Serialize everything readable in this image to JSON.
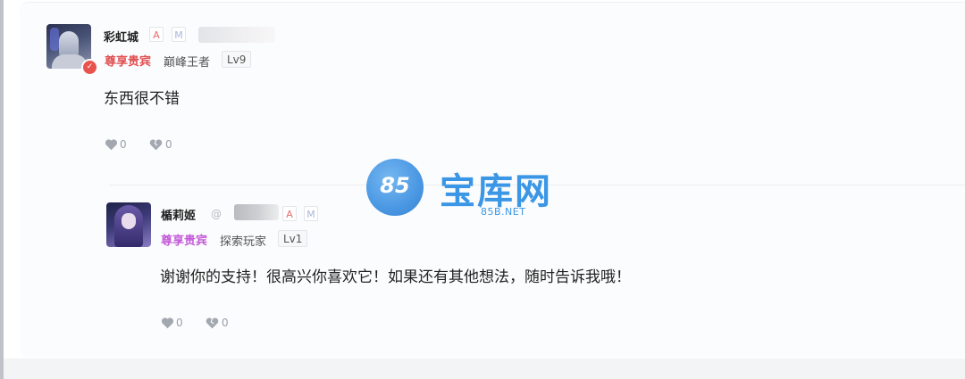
{
  "comment": {
    "username": "彩虹城",
    "badge_a": "A",
    "badge_m": "M",
    "vip_tag": "尊享贵宾",
    "title": "巅峰王者",
    "level": "Lv9",
    "text": "东西很不错",
    "likes": "0",
    "dislikes": "0"
  },
  "reply": {
    "username": "楯莉姬",
    "at": "@",
    "badge_a": "A",
    "badge_m": "M",
    "vip_tag": "尊享贵宾",
    "title": "探索玩家",
    "level": "Lv1",
    "text": "谢谢你的支持！很高兴你喜欢它！如果还有其他想法，随时告诉我哦！",
    "likes": "0",
    "dislikes": "0"
  },
  "watermark": {
    "circle_text": "85",
    "title": "宝库网",
    "subtitle": "85B.NET"
  },
  "colors": {
    "vip_red": "#e14f52",
    "vip_purple": "#c35ad8",
    "watermark_blue": "#3b97e6"
  }
}
